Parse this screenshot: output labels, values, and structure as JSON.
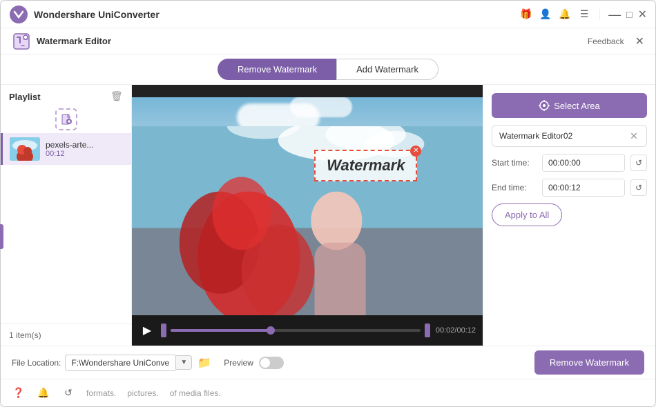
{
  "app": {
    "name": "Wondershare UniConverter",
    "logo_color": "#8b6bb1"
  },
  "titlebar": {
    "title": "Wondershare UniConverter",
    "icons": [
      "gift-icon",
      "account-icon",
      "bell-icon",
      "menu-icon"
    ],
    "window_controls": [
      "minimize",
      "maximize",
      "close"
    ],
    "feedback": "Feedback"
  },
  "subheader": {
    "title": "Watermark Editor"
  },
  "tabs": {
    "remove_label": "Remove Watermark",
    "add_label": "Add Watermark",
    "active": "remove"
  },
  "sidebar": {
    "title": "Playlist",
    "items": [
      {
        "name": "pexels-arte...",
        "duration": "00:12"
      }
    ],
    "item_count": "1 item(s)"
  },
  "video": {
    "watermark_text": "Watermark",
    "current_time": "00:02",
    "total_time": "00:12",
    "time_display": "00:02/00:12"
  },
  "right_panel": {
    "select_area_label": "Select Area",
    "watermark_tag": "Watermark Editor02",
    "start_time_label": "Start time:",
    "start_time_value": "00:00:00",
    "end_time_label": "End time:",
    "end_time_value": "00:00:12",
    "apply_all_label": "Apply to All"
  },
  "bottom_bar": {
    "file_location_label": "File Location:",
    "file_path": "F:\\Wondershare UniConverter",
    "preview_label": "Preview",
    "remove_watermark_label": "Remove Watermark"
  },
  "util_bar": {
    "texts": [
      "formats.",
      "pictures.",
      "of media files."
    ]
  }
}
